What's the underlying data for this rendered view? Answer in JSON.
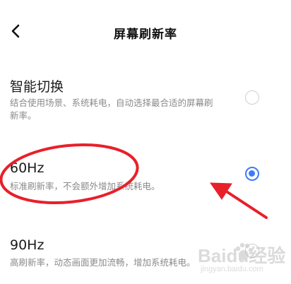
{
  "header": {
    "title": "屏幕刷新率",
    "back_icon": "chevron-left-icon"
  },
  "options": [
    {
      "title": "智能切换",
      "description": "结合使用场景、系统耗电，自动选择最合适的屏幕刷新率。",
      "selected": false
    },
    {
      "title": "60Hz",
      "description": "标准刷新率，不会额外增加系统耗电。",
      "selected": true
    },
    {
      "title": "90Hz",
      "description": "高刷新率，动态画面更加流畅，增加系统耗电。",
      "selected": false
    }
  ],
  "watermark": {
    "main": "Baidu经验",
    "sub": "jingyan.baidu.com"
  },
  "colors": {
    "accent": "#3f7af6",
    "annotation": "#e8202a"
  }
}
